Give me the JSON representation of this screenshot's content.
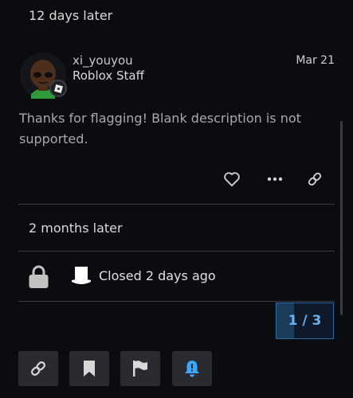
{
  "topic": {
    "gap_before_post": "12 days later",
    "post": {
      "username": "xi_youyou",
      "user_title": "Roblox Staff",
      "date": "Mar 21",
      "body": "Thanks for flagging! Blank description is not supported.",
      "actions": [
        "heart-icon",
        "more-icon",
        "link-icon"
      ]
    },
    "gap_after_post": "2 months later",
    "closed_notice": {
      "text": "Closed 2 days ago",
      "icons": [
        "lock-icon",
        "top-hat-avatar-icon"
      ]
    },
    "progress": {
      "label": "1 / 3",
      "current": 1,
      "total": 3
    },
    "footer_buttons": [
      "link-icon",
      "bookmark-icon",
      "flag-icon",
      "bell-alert-icon"
    ],
    "colors": {
      "background": "#0b0c10",
      "button": "#2a2b30",
      "accent": "#3ea6ff"
    }
  }
}
